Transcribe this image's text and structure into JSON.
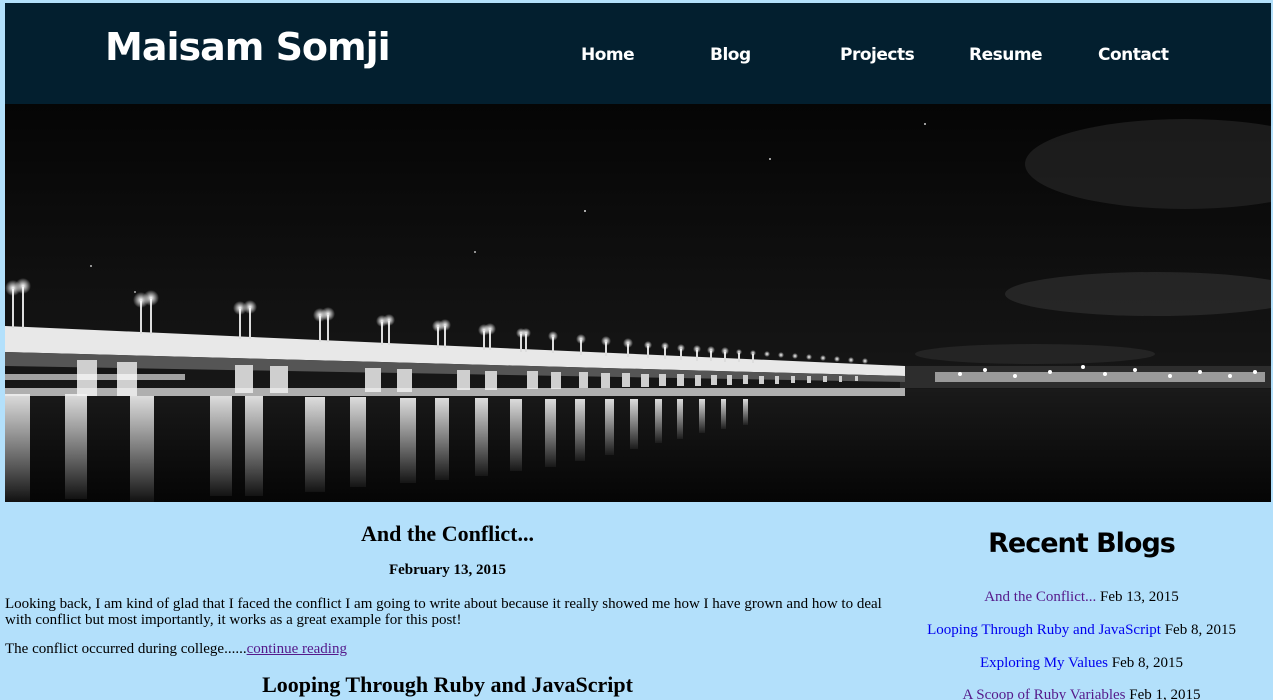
{
  "header": {
    "site_title": "Maisam Somji",
    "nav": [
      "Home",
      "Blog",
      "Projects",
      "Resume",
      "Contact"
    ]
  },
  "hero": {
    "description": "Black and white night photo of a long illuminated bridge over water"
  },
  "posts": [
    {
      "title": "And the Conflict...",
      "date": "February 13, 2015",
      "excerpt": "Looking back, I am kind of glad that I faced the conflict I am going to write about because it really showed me how I have grown and how to deal with conflict but most importantly, it works as a great example for this post!",
      "more_prefix": "The conflict occurred during college......",
      "more_link": "continue reading"
    },
    {
      "title": "Looping Through Ruby and JavaScript"
    }
  ],
  "sidebar": {
    "title": "Recent Blogs",
    "items": [
      {
        "link": "And the Conflict...",
        "date": "Feb 13, 2015"
      },
      {
        "link": "Looping Through Ruby and JavaScript",
        "date": "Feb 8, 2015"
      },
      {
        "link": "Exploring My Values",
        "date": "Feb 8, 2015"
      },
      {
        "link": "A Scoop of Ruby Variables",
        "date": "Feb 1, 2015"
      }
    ]
  },
  "colors": {
    "header_bg": "#031f2f",
    "page_bg": "#b3e0fb",
    "visited_link": "#551a8b",
    "link": "#0000ee"
  }
}
